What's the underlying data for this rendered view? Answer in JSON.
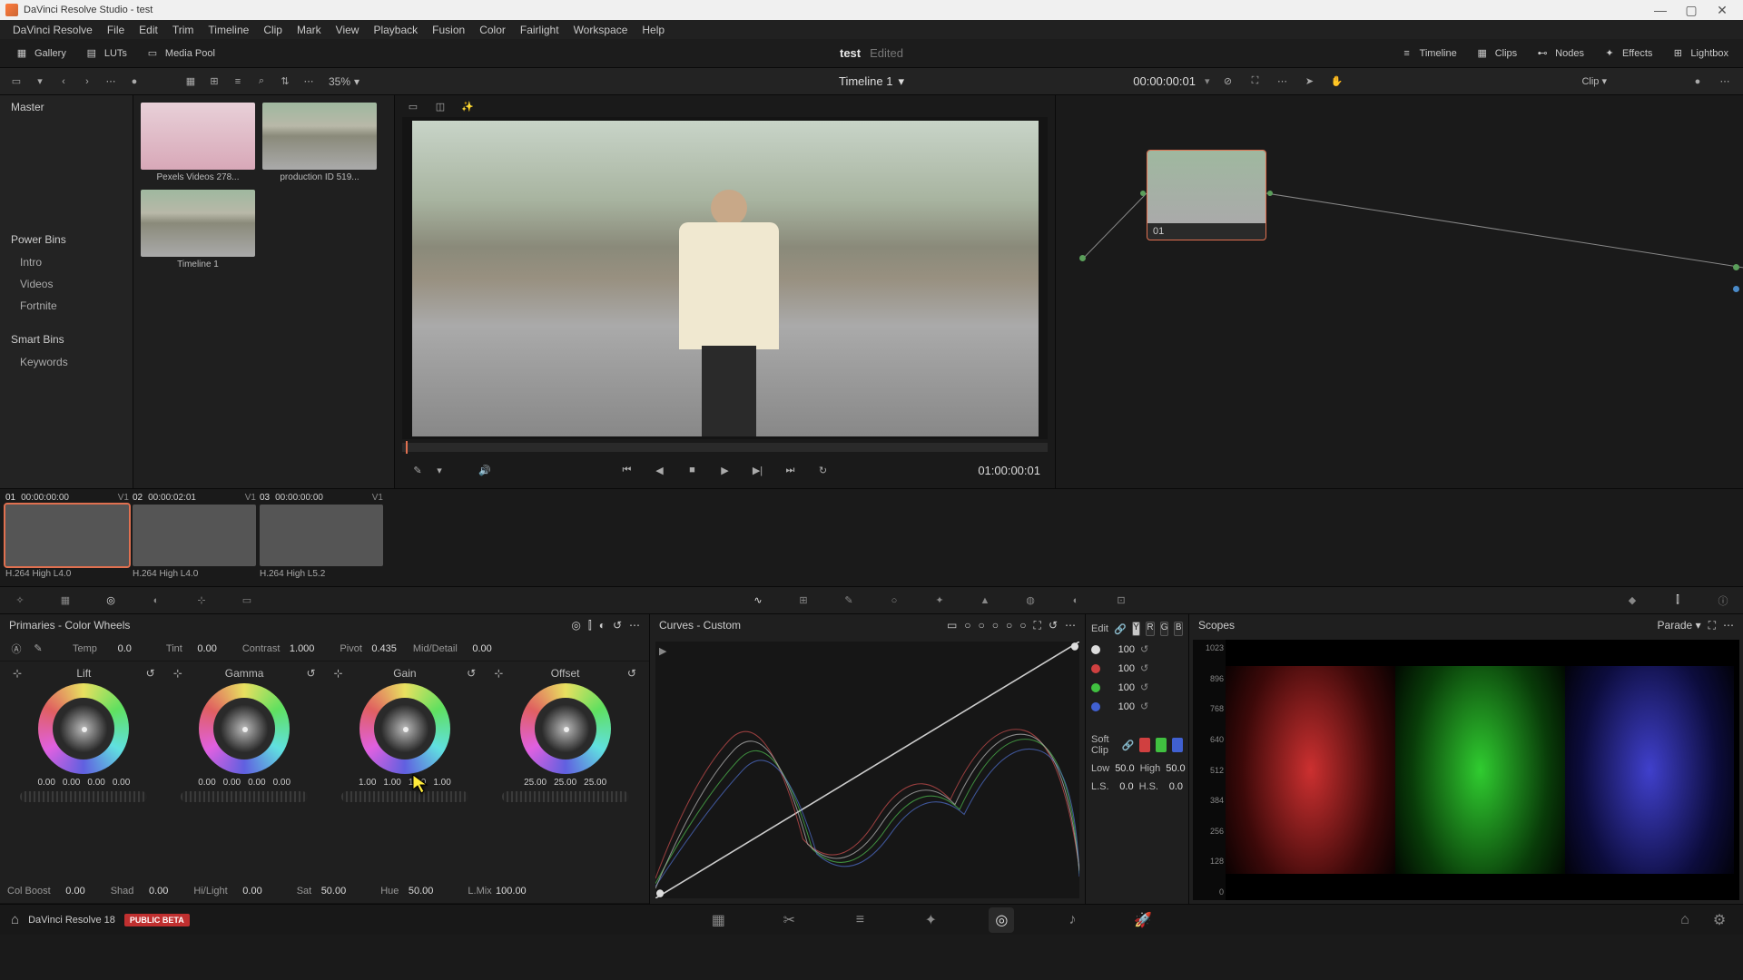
{
  "window": {
    "title": "DaVinci Resolve Studio - test",
    "min": "—",
    "max": "▢",
    "close": "✕"
  },
  "menu": [
    "DaVinci Resolve",
    "File",
    "Edit",
    "Trim",
    "Timeline",
    "Clip",
    "Mark",
    "View",
    "Playback",
    "Fusion",
    "Color",
    "Fairlight",
    "Workspace",
    "Help"
  ],
  "toolbar": {
    "gallery": "Gallery",
    "luts": "LUTs",
    "mediapool": "Media Pool",
    "project": "test",
    "edited": "Edited",
    "timeline": "Timeline",
    "clips": "Clips",
    "nodes": "Nodes",
    "effects": "Effects",
    "lightbox": "Lightbox"
  },
  "secbar": {
    "zoom": "35%",
    "tl_name": "Timeline 1",
    "tc": "00:00:00:01",
    "clip": "Clip"
  },
  "sidebar": {
    "master": "Master",
    "powerbins": "Power Bins",
    "pb_items": [
      "Intro",
      "Videos",
      "Fortnite"
    ],
    "smartbins": "Smart Bins",
    "sb_items": [
      "Keywords"
    ]
  },
  "media": [
    {
      "name": "Pexels Videos 278...",
      "cls": "pink-bg"
    },
    {
      "name": "production ID 519...",
      "cls": "stadium-bg"
    },
    {
      "name": "Timeline 1",
      "cls": "stadium-bg"
    }
  ],
  "viewer": {
    "tc": "01:00:00:01"
  },
  "node": {
    "label": "01"
  },
  "tlclips": [
    {
      "num": "01",
      "tc": "00:00:00:00",
      "trk": "V1",
      "cls": "stadium-bg",
      "codec": "H.264 High L4.0",
      "sel": true
    },
    {
      "num": "02",
      "tc": "00:00:02:01",
      "trk": "V1",
      "cls": "stadium-bg",
      "codec": "H.264 High L4.0",
      "sel": false
    },
    {
      "num": "03",
      "tc": "00:00:00:00",
      "trk": "V1",
      "cls": "pink-bg",
      "codec": "H.264 High L5.2",
      "sel": false
    }
  ],
  "primaries": {
    "title": "Primaries - Color Wheels",
    "params1": {
      "temp_l": "Temp",
      "temp_v": "0.0",
      "tint_l": "Tint",
      "tint_v": "0.00",
      "contrast_l": "Contrast",
      "contrast_v": "1.000",
      "pivot_l": "Pivot",
      "pivot_v": "0.435",
      "md_l": "Mid/Detail",
      "md_v": "0.00"
    },
    "wheels": [
      {
        "name": "Lift",
        "vals": [
          "0.00",
          "0.00",
          "0.00",
          "0.00"
        ]
      },
      {
        "name": "Gamma",
        "vals": [
          "0.00",
          "0.00",
          "0.00",
          "0.00"
        ]
      },
      {
        "name": "Gain",
        "vals": [
          "1.00",
          "1.00",
          "1.00",
          "1.00"
        ]
      },
      {
        "name": "Offset",
        "vals": [
          "25.00",
          "25.00",
          "25.00"
        ]
      }
    ],
    "params2": {
      "cb_l": "Col Boost",
      "cb_v": "0.00",
      "shad_l": "Shad",
      "shad_v": "0.00",
      "hl_l": "Hi/Light",
      "hl_v": "0.00",
      "sat_l": "Sat",
      "sat_v": "50.00",
      "hue_l": "Hue",
      "hue_v": "50.00",
      "lm_l": "L.Mix",
      "lm_v": "100.00"
    }
  },
  "curves": {
    "title": "Curves - Custom",
    "edit": "Edit",
    "y": "Y",
    "r": "R",
    "g": "G",
    "b": "B",
    "ch_vals": [
      "100",
      "100",
      "100",
      "100"
    ],
    "softclip": "Soft Clip",
    "low_l": "Low",
    "low_v": "50.0",
    "high_l": "High",
    "high_v": "50.0",
    "ls_l": "L.S.",
    "ls_v": "0.0",
    "hs_l": "H.S.",
    "hs_v": "0.0"
  },
  "scopes": {
    "title": "Scopes",
    "mode": "Parade",
    "ticks": [
      "1023",
      "896",
      "768",
      "640",
      "512",
      "384",
      "256",
      "128",
      "0"
    ]
  },
  "footer": {
    "app": "DaVinci Resolve 18",
    "beta": "PUBLIC BETA"
  }
}
